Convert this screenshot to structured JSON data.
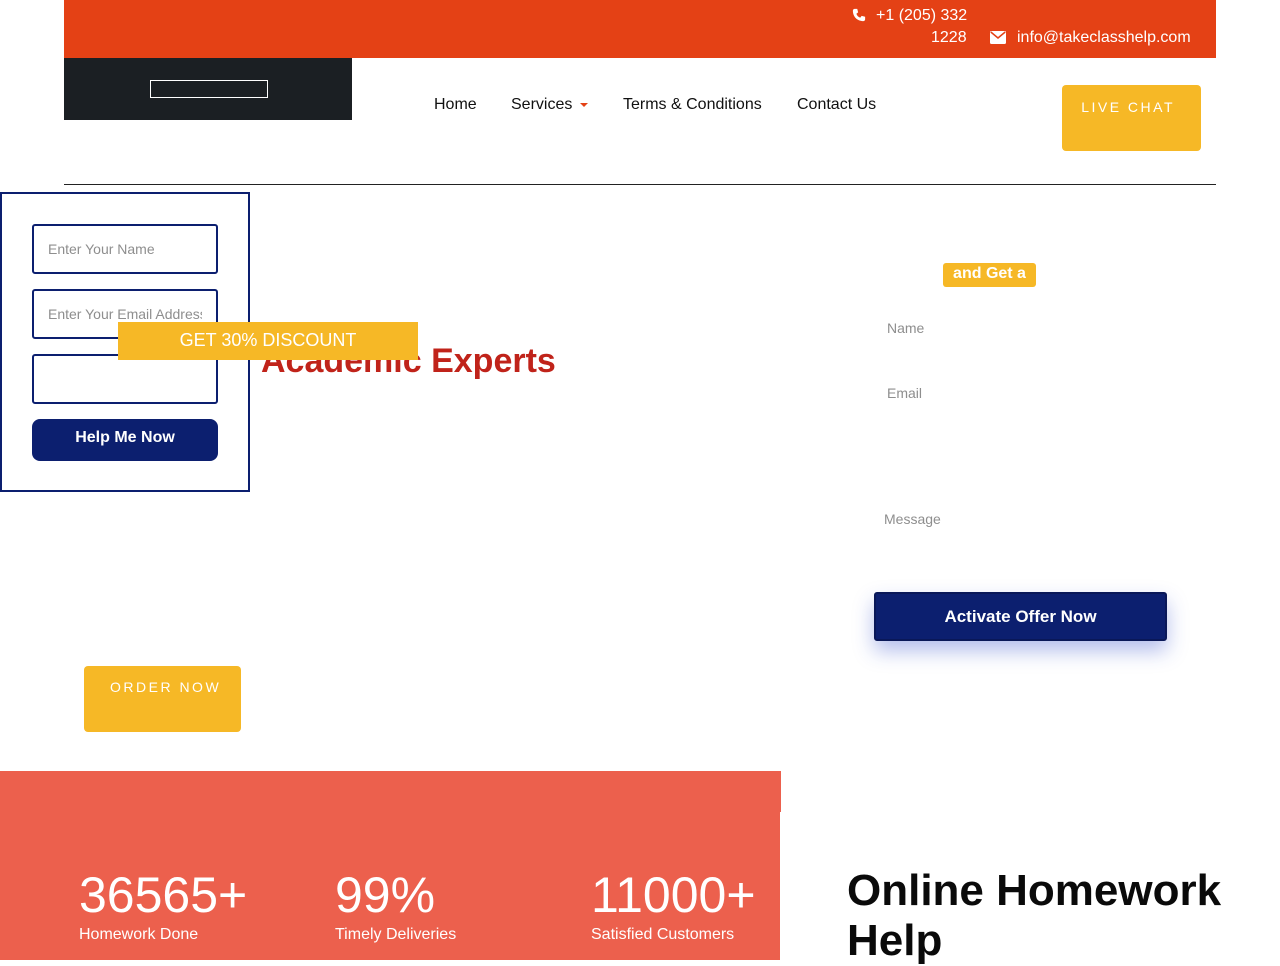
{
  "topbar": {
    "phone_line1": "+1 (205) 332",
    "phone_line2": "1228",
    "email": "info@takeclasshelp.com",
    "icons": {
      "phone": "phone-icon",
      "mail": "envelope-icon"
    }
  },
  "nav": {
    "items": [
      {
        "label": "Home"
      },
      {
        "label": "Services"
      },
      {
        "label": "Terms & Conditions"
      },
      {
        "label": "Contact Us"
      }
    ],
    "live_chat": "LIVE CHAT"
  },
  "left_form": {
    "name_placeholder": "Enter Your Name",
    "email_placeholder": "Enter Your Email Address",
    "submit": "Help Me Now"
  },
  "hero": {
    "discount": "GET 30% DISCOUNT",
    "headline": "Academic Experts",
    "order_now": "ORDER NOW"
  },
  "right_form": {
    "badge": "and Get a",
    "name_label": "Name",
    "email_label": "Email",
    "message_label": "Message",
    "submit": "Activate Offer Now"
  },
  "stats": [
    {
      "value": "36565+",
      "label": "Homework Done"
    },
    {
      "value": "99%",
      "label": "Timely Deliveries"
    },
    {
      "value": "11000+",
      "label": "Satisfied Customers"
    }
  ],
  "section": {
    "title": "Online Homework Help"
  },
  "colors": {
    "topbar": "#e44115",
    "accent_yellow": "#f6b826",
    "navy": "#0c1f6f",
    "headline_red": "#c0231a",
    "stats_band": "#ec604d",
    "logo_bg": "#1b1f23"
  }
}
